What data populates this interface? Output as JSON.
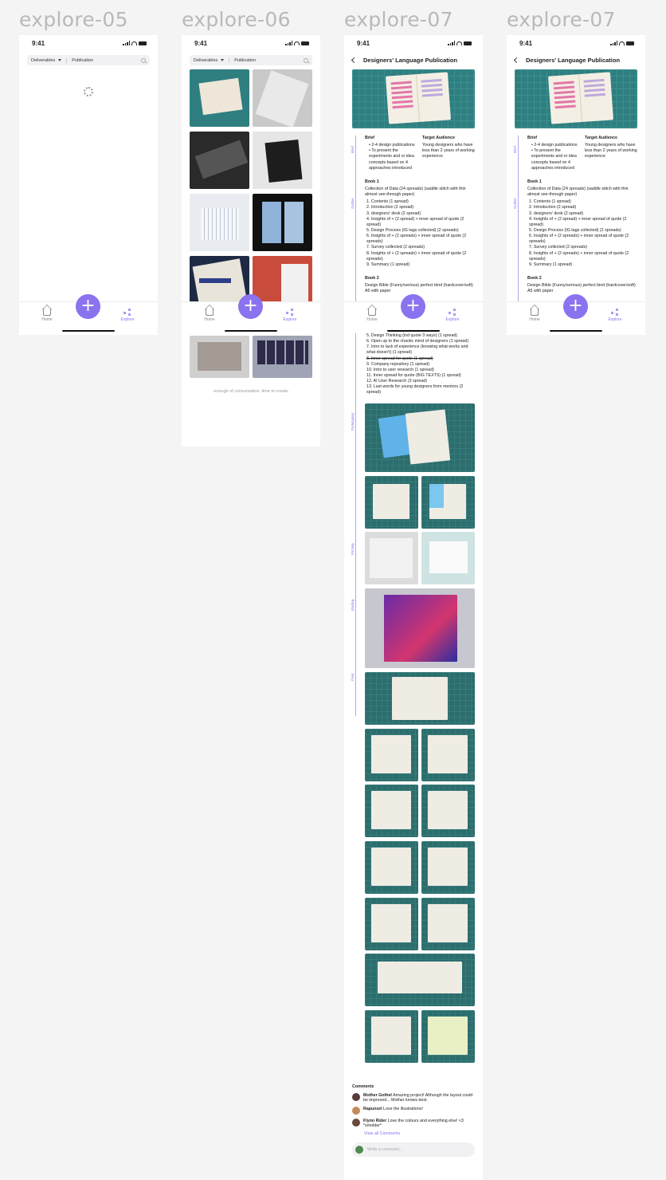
{
  "frames": [
    {
      "title": "explore-05"
    },
    {
      "title": "explore-06"
    },
    {
      "title": "explore-07"
    },
    {
      "title": "explore-07"
    }
  ],
  "status": {
    "time": "9:41"
  },
  "search": {
    "filter": "Deliverables",
    "query": "Publication"
  },
  "tabbar": {
    "home": "Home",
    "explore": "Explore",
    "fab": "+"
  },
  "explore06": {
    "footer": "enough of consumation. time to create"
  },
  "detail": {
    "title": "Designers' Language Publication",
    "brief_heading": "Brief",
    "brief_items": [
      "2-4 design publications",
      "To present the experiments and or idea concepts based on 4 approaches introduced"
    ],
    "audience_heading": "Target Audience",
    "audience_text": "Young designers who have less than 2 years of working experience",
    "rail_labels": [
      "Brief",
      "Outline",
      "Prototyping",
      "Printing",
      "Binding",
      "Final"
    ],
    "book1_heading": "Book 1",
    "book1_desc": "Collection of Data (24 spreads) (saddle stitch with thin almost see-through paper)",
    "book1_items": [
      "1. Contents (1 spread)",
      "2. Introduction (2 spread)",
      "3. designers' desk (2 spread)",
      "4. Insights of + (2 spread) + inner spread of quote (2 spread)",
      "5. Design Process (IG tags collected) (2 spreads)",
      "6. Insights of + (2 spreads) + inner spread of quote (2 spreads)",
      "7. Survey collected (2 spreads)",
      "8. Insights of + (2 spreads) + inner spread of quote (2 spreads)",
      "9. Summary (1 spread)"
    ],
    "book2_heading": "Book 2",
    "book2_desc": "Design Bible (Funny/serious) perfect bind (hardcover/soft) A5 with paper",
    "book2_items": [
      "5. Design Thinking (ind quote 3 ways) (1 spread)",
      "6. Open up to the chaotic mind of designers (1 spread)",
      "7. Intro to lack of experience (knowing what works and what doesn't) (1 spread)",
      "8. Inner spread for quote (1 spread)",
      "9. Company repository (1 spread)",
      "10. Intro to user research (1 spread)",
      "11. Inner spread for quote (BIG TEXTS) (1 spread)",
      "12. AI User Research (3 spread)",
      "13. Last words for young designers from mentors (2 spread)"
    ]
  },
  "comments": {
    "heading": "Comments",
    "items": [
      {
        "name": "Mother Gothel",
        "text": "Amazing project! Although the layout could be improved... Mother knows best."
      },
      {
        "name": "Rapunzel",
        "text": "Love the illustrations!"
      },
      {
        "name": "Flynn Rider",
        "text": "Love the colours and everything else! <3 *smolder*"
      }
    ],
    "view_all": "View all Comments",
    "placeholder": "Write a comment..."
  },
  "colors": {
    "accent": "#8b72ef",
    "teal": "#2f7f80",
    "title_gray": "#b9b9b9"
  }
}
